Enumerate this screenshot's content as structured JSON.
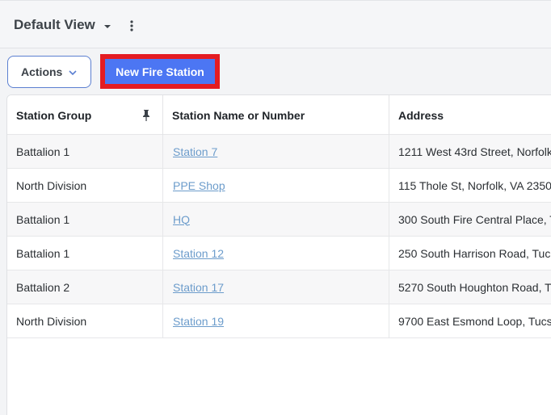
{
  "header": {
    "view_title": "Default View"
  },
  "toolbar": {
    "actions_label": "Actions",
    "new_label": "New Fire Station"
  },
  "table": {
    "columns": [
      "Station Group",
      "Station Name or Number",
      "Address"
    ],
    "rows": [
      {
        "group": "Battalion 1",
        "name": "Station 7",
        "address": "1211 West 43rd Street, Norfolk"
      },
      {
        "group": "North Division",
        "name": "PPE Shop",
        "address": "115 Thole St, Norfolk, VA 2350"
      },
      {
        "group": "Battalion 1",
        "name": "HQ",
        "address": "300 South Fire Central Place, T"
      },
      {
        "group": "Battalion 1",
        "name": "Station 12",
        "address": "250 South Harrison Road, Tuc"
      },
      {
        "group": "Battalion 2",
        "name": "Station 17",
        "address": "5270 South Houghton Road, T"
      },
      {
        "group": "North Division",
        "name": "Station 19",
        "address": "9700 East Esmond Loop, Tucs"
      }
    ]
  },
  "colors": {
    "primary": "#4c76f3",
    "highlight": "#e41c22",
    "link": "#6c9ccb"
  },
  "icons": {
    "view_caret": "caret-down-icon",
    "view_menu": "kebab-menu-icon",
    "actions_chevron": "chevron-down-icon",
    "pin": "pin-icon"
  }
}
